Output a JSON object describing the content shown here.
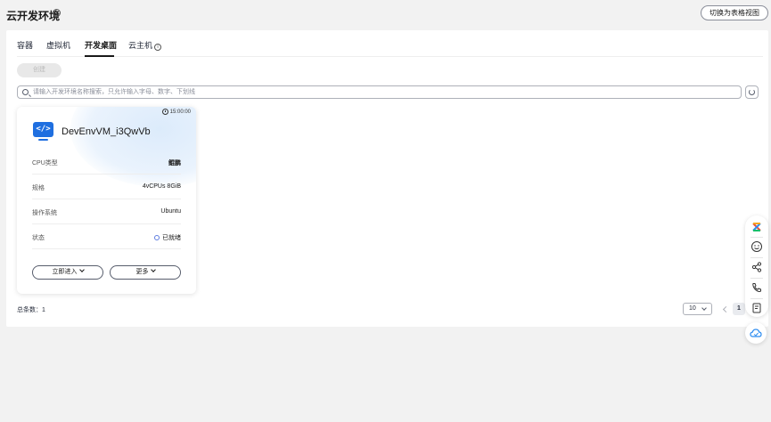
{
  "header": {
    "title": "云开发环境",
    "switch_view_label": "切换为表格视图"
  },
  "tabs": [
    {
      "label": "容器"
    },
    {
      "label": "虚拟机"
    },
    {
      "label": "开发桌面",
      "active": true
    },
    {
      "label": "云主机"
    }
  ],
  "toolbar": {
    "create_label": "创建"
  },
  "search": {
    "placeholder": "请输入开发环境名称搜索，只允许输入字母、数字、下划线"
  },
  "card": {
    "time": "15:00:00",
    "name": "DevEnvVM_i3QwVb",
    "rows": [
      {
        "label": "CPU类型",
        "value": "鲲鹏"
      },
      {
        "label": "规格",
        "value": "4vCPUs 8GiB"
      },
      {
        "label": "操作系统",
        "value": "Ubuntu"
      },
      {
        "label": "状态",
        "value": "已就绪"
      }
    ],
    "enter_label": "立即进入",
    "more_label": "更多"
  },
  "pagination": {
    "total_label": "总条数：1",
    "page_size": "10",
    "current_page": "1"
  },
  "colors": {
    "accent": "#1f6fe0",
    "status_ready": "#5e7ce0"
  }
}
